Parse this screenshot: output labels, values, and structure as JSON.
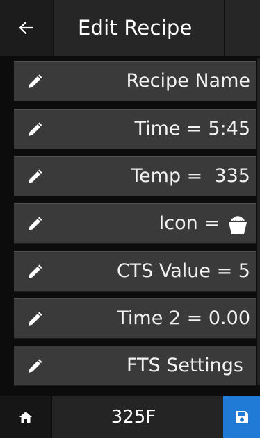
{
  "header": {
    "back_icon": "arrow-left-icon",
    "title": "Edit Recipe"
  },
  "rows": [
    {
      "label": "Recipe Name",
      "icon": "pencil-icon"
    },
    {
      "label": "Time = 5:45",
      "icon": "pencil-icon"
    },
    {
      "label": "Temp =  335",
      "icon": "pencil-icon"
    },
    {
      "label": "Icon =",
      "icon": "pencil-icon",
      "value_icon": "fries-basket-icon"
    },
    {
      "label": "CTS Value = 5",
      "icon": "pencil-icon"
    },
    {
      "label": "Time 2 = 0.00",
      "icon": "pencil-icon"
    },
    {
      "label": "FTS Settings",
      "icon": "pencil-icon"
    }
  ],
  "footer": {
    "home_icon": "home-icon",
    "temperature": "325F",
    "save_icon": "floppy-disk-icon"
  },
  "colors": {
    "accent": "#1f7bd6",
    "row_bg": "#3a3a3a",
    "background": "#000000"
  }
}
